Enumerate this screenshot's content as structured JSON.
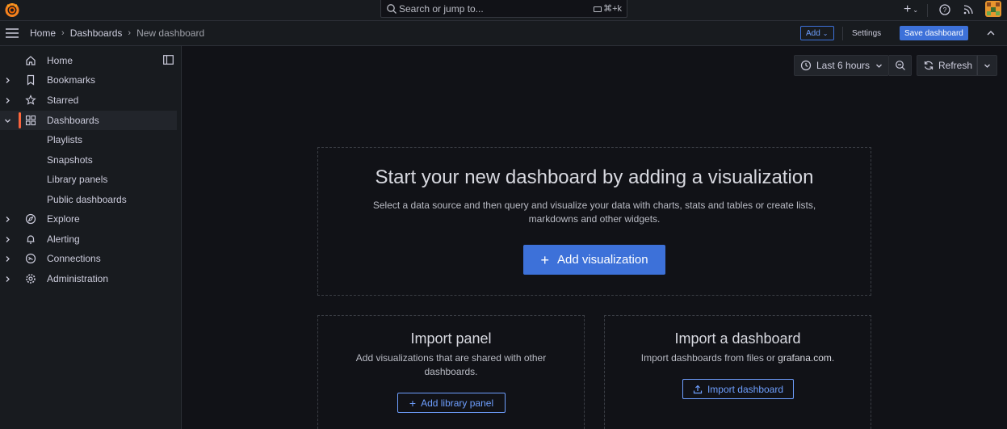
{
  "topbar": {
    "search_placeholder": "Search or jump to...",
    "search_shortcut": "⌘+k"
  },
  "breadcrumb": [
    "Home",
    "Dashboards",
    "New dashboard"
  ],
  "actions": {
    "add": "Add",
    "settings": "Settings",
    "save": "Save dashboard"
  },
  "sidebar": {
    "items": [
      {
        "label": "Home",
        "icon": "home-icon",
        "chevron": false
      },
      {
        "label": "Bookmarks",
        "icon": "bookmark-icon",
        "chevron": true
      },
      {
        "label": "Starred",
        "icon": "star-icon",
        "chevron": true
      },
      {
        "label": "Dashboards",
        "icon": "apps-icon",
        "chevron": true,
        "active": true
      },
      {
        "label": "Playlists",
        "sub": true
      },
      {
        "label": "Snapshots",
        "sub": true
      },
      {
        "label": "Library panels",
        "sub": true
      },
      {
        "label": "Public dashboards",
        "sub": true
      },
      {
        "label": "Explore",
        "icon": "compass-icon",
        "chevron": true
      },
      {
        "label": "Alerting",
        "icon": "bell-icon",
        "chevron": true
      },
      {
        "label": "Connections",
        "icon": "connections-icon",
        "chevron": true
      },
      {
        "label": "Administration",
        "icon": "cog-icon",
        "chevron": true
      }
    ]
  },
  "toolbar": {
    "time_range": "Last 6 hours",
    "refresh": "Refresh"
  },
  "hero": {
    "title": "Start your new dashboard by adding a visualization",
    "description": "Select a data source and then query and visualize your data with charts, stats and tables or create lists, markdowns and other widgets.",
    "button": "Add visualization"
  },
  "import_panel": {
    "title": "Import panel",
    "description": "Add visualizations that are shared with other dashboards.",
    "button": "Add library panel"
  },
  "import_dashboard": {
    "title": "Import a dashboard",
    "description_prefix": "Import dashboards from files or ",
    "description_link": "grafana.com",
    "description_suffix": ".",
    "button": "Import dashboard"
  },
  "colors": {
    "primary": "#3d71d9",
    "brand": "#f55f3e",
    "background": "#111217",
    "surface": "#181b1f"
  }
}
